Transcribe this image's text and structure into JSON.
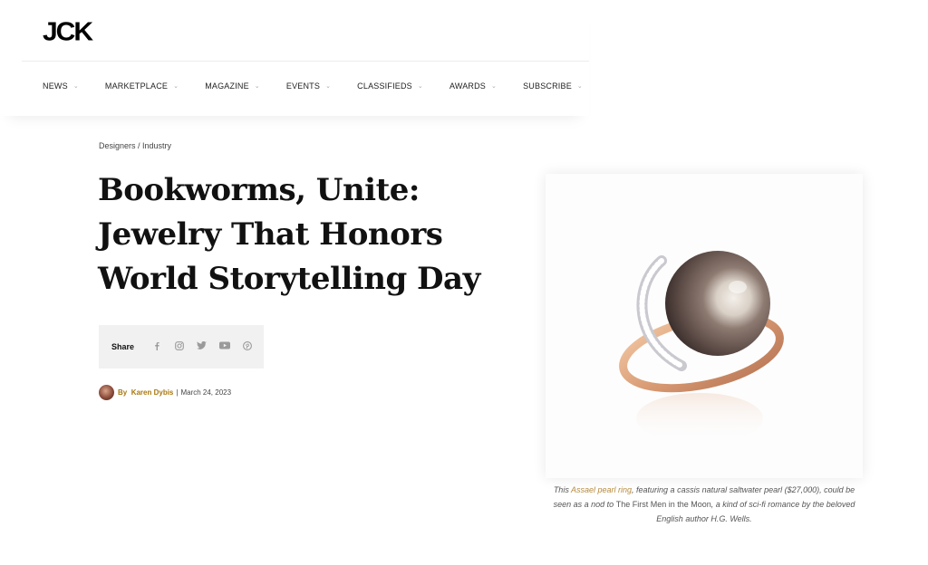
{
  "header": {
    "logo": "JCK",
    "nav": [
      {
        "label": "NEWS"
      },
      {
        "label": "MARKETPLACE"
      },
      {
        "label": "MAGAZINE"
      },
      {
        "label": "EVENTS"
      },
      {
        "label": "CLASSIFIEDS"
      },
      {
        "label": "AWARDS"
      },
      {
        "label": "SUBSCRIBE"
      }
    ],
    "chevron_icon": "chevron-down-icon"
  },
  "article": {
    "breadcrumb": "Designers / Industry",
    "title": "Bookworms, Unite: Jewelry That Honors World Storytelling Day",
    "share": {
      "label": "Share",
      "icons": [
        "facebook-icon",
        "instagram-icon",
        "twitter-icon",
        "youtube-icon",
        "pinterest-icon"
      ]
    },
    "byline": {
      "by": "By",
      "author": "Karen Dybis",
      "separator": "|",
      "date": "March 24, 2023"
    },
    "image": {
      "caption_before": "This ",
      "caption_link": "Assael pearl ring",
      "caption_mid": ", featuring a cassis natural saltwater pearl ($27,000), could be seen as a nod to ",
      "caption_book": "The First Men in the Moon",
      "caption_after": ", a kind of sci-fi romance by the beloved English author H.G. Wells."
    }
  },
  "colors": {
    "accent_gold": "#a9770e",
    "caption_link": "#b68a3e",
    "share_bg": "#f1f1f1"
  }
}
